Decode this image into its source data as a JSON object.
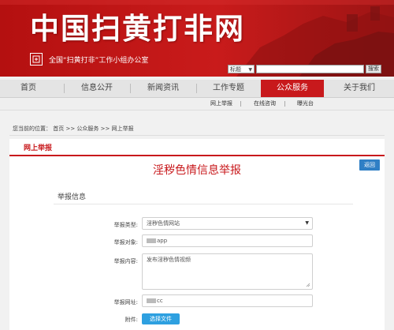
{
  "header": {
    "site_title": "中国扫黄打非网",
    "subtitle": "全国“扫黄打非”工作小组办公室",
    "search": {
      "select_value": "标题",
      "button_label": "搜索"
    }
  },
  "nav": {
    "items": [
      {
        "label": "首页"
      },
      {
        "label": "信息公开"
      },
      {
        "label": "新闻资讯"
      },
      {
        "label": "工作专题"
      },
      {
        "label": "公众服务"
      },
      {
        "label": "关于我们"
      }
    ],
    "active_index": 4,
    "subnav": [
      "网上举报",
      "在线咨询",
      "曝光台"
    ]
  },
  "breadcrumb": "您当前的位置： 首页 >> 公众服务 >> 网上举报",
  "section": {
    "title": "网上举报"
  },
  "form": {
    "title": "淫秽色情信息举报",
    "back_label": "返回",
    "group_title": "举报信息",
    "fields": {
      "type": {
        "label": "举报类型:",
        "value": "淫秽色情网站"
      },
      "target": {
        "label": "举报对象:",
        "value": "app"
      },
      "content": {
        "label": "举报内容:",
        "value": "发布淫秽色情视频"
      },
      "url": {
        "label": "举报网址:",
        "value": "cc"
      },
      "attachment": {
        "label": "附件:",
        "button_label": "选择文件"
      }
    }
  },
  "colors": {
    "brand_red": "#c8191c",
    "link_blue": "#2f7fc5",
    "upload_blue": "#2ea0e0"
  }
}
